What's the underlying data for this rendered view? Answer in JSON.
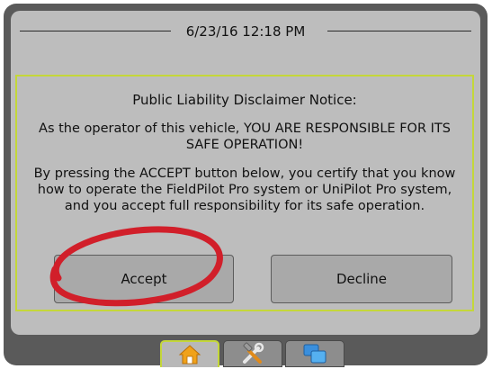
{
  "header": {
    "datetime": "6/23/16 12:18 PM"
  },
  "dialog": {
    "title": "Public Liability Disclaimer Notice:",
    "paragraph1": "As the operator of this vehicle, YOU ARE RESPONSIBLE FOR ITS SAFE OPERATION!",
    "paragraph2": "By pressing the ACCEPT button below, you certify that you know how to operate the FieldPilot Pro system or UniPilot Pro system, and you accept full responsibility for its safe operation.",
    "accept_label": "Accept",
    "decline_label": "Decline"
  },
  "bottom_tabs": [
    {
      "icon": "home-icon",
      "selected": true
    },
    {
      "icon": "tools-icon",
      "selected": false
    },
    {
      "icon": "screens-icon",
      "selected": false
    }
  ],
  "colors": {
    "screen_bg": "#bdbdbd",
    "accent": "#c4d73a",
    "annotation": "#d11f2a",
    "bezel": "#5a5a5a"
  }
}
